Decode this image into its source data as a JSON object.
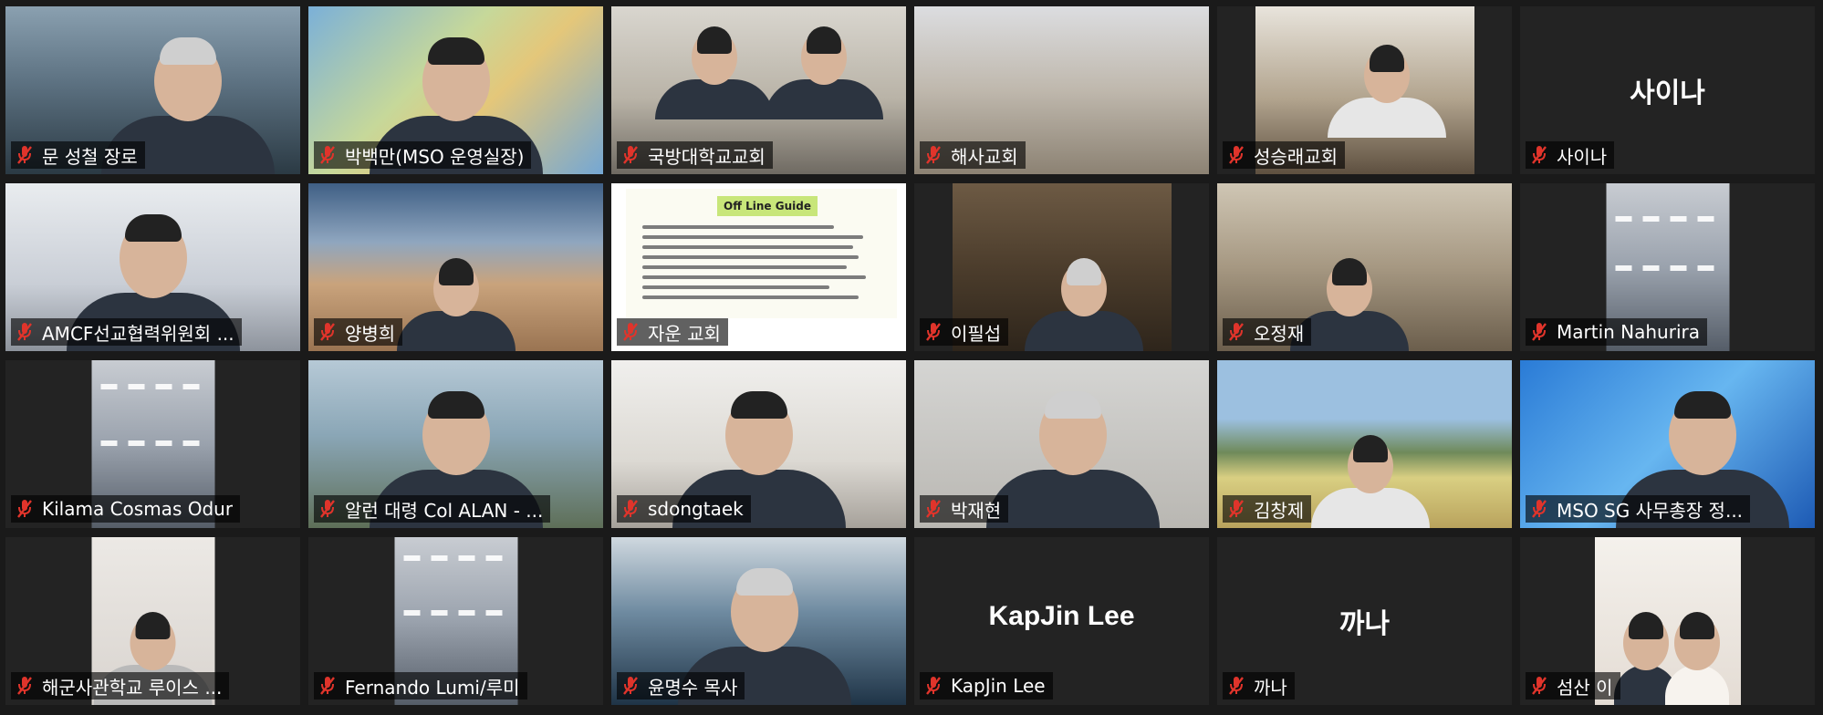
{
  "participants": [
    {
      "name": "문 성철 장로"
    },
    {
      "name": "박백만(MSO 운영실장)"
    },
    {
      "name": "국방대학교교회"
    },
    {
      "name": "해사교회"
    },
    {
      "name": "성승래교회"
    },
    {
      "name": "사이나",
      "tile_text": "사이나"
    },
    {
      "name": "AMCF선교협력위원회 ..."
    },
    {
      "name": "양병희"
    },
    {
      "name": "자운 교회",
      "slide_title": "Off Line Guide"
    },
    {
      "name": "이필섭"
    },
    {
      "name": "오정재"
    },
    {
      "name": "Martin Nahurira"
    },
    {
      "name": "Kilama Cosmas Odur"
    },
    {
      "name": "알런 대령 Col ALAN - ..."
    },
    {
      "name": "sdongtaek"
    },
    {
      "name": "박재현"
    },
    {
      "name": "김창제"
    },
    {
      "name": "MSO SG 사무총장 정..."
    },
    {
      "name": "해군사관학교 루이스 ..."
    },
    {
      "name": "Fernando Lumi/루미"
    },
    {
      "name": "윤명수 목사"
    },
    {
      "name": "KapJin Lee",
      "tile_text": "KapJin Lee"
    },
    {
      "name": "까나",
      "tile_text": "까나"
    },
    {
      "name": "섬산 이"
    }
  ],
  "colors": {
    "active_speaker_border": "#d8e64a",
    "muted_icon": "#e0342b",
    "background": "#1a1a1a"
  },
  "icons": {
    "muted": "microphone-muted-icon"
  }
}
